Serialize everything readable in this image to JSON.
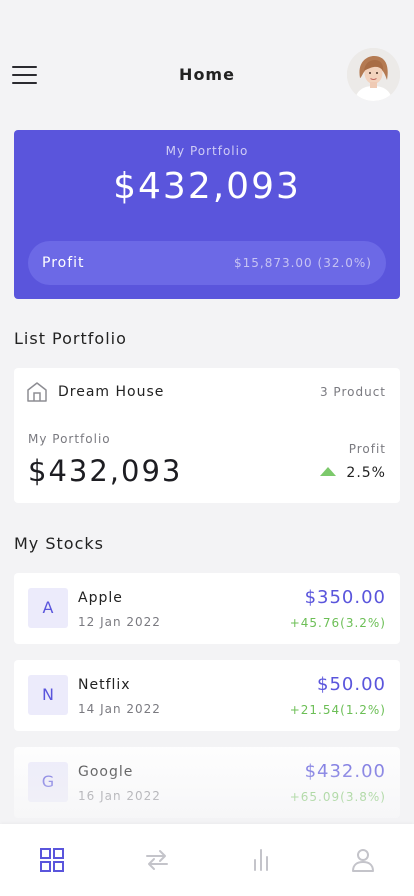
{
  "header": {
    "title": "Home",
    "menu_icon": "hamburger-menu-icon",
    "avatar": "user-avatar"
  },
  "portfolio": {
    "label": "My Portfolio",
    "value": "$432,093",
    "profit_label": "Profit",
    "profit_value": "$15,873.00 (32.0%)",
    "accent_color": "#5a55dc"
  },
  "list_portfolio": {
    "title": "List Portfolio",
    "item": {
      "icon": "house-icon",
      "name": "Dream House",
      "count": "3 Product",
      "portfolio_label": "My Portfolio",
      "portfolio_value": "$432,093",
      "profit_label": "Profit",
      "profit_value": "2.5%",
      "trend_icon": "triangle-up-icon"
    }
  },
  "stocks": {
    "title": "My Stocks",
    "items": [
      {
        "letter": "A",
        "name": "Apple",
        "date": "12 Jan 2022",
        "price": "$350.00",
        "change": "+45.76(3.2%)"
      },
      {
        "letter": "N",
        "name": "Netflix",
        "date": "14 Jan 2022",
        "price": "$50.00",
        "change": "+21.54(1.2%)"
      },
      {
        "letter": "G",
        "name": "Google",
        "date": "16 Jan 2022",
        "price": "$432.00",
        "change": "+65.09(3.8%)"
      }
    ],
    "positive_color": "#6cbf56"
  },
  "bottom_nav": {
    "items": [
      {
        "icon": "grid-icon",
        "active": true
      },
      {
        "icon": "transfer-arrows-icon",
        "active": false
      },
      {
        "icon": "bar-chart-icon",
        "active": false
      },
      {
        "icon": "profile-icon",
        "active": false
      }
    ],
    "active_color": "#5a55dc",
    "inactive_color": "#c4c4ca"
  }
}
